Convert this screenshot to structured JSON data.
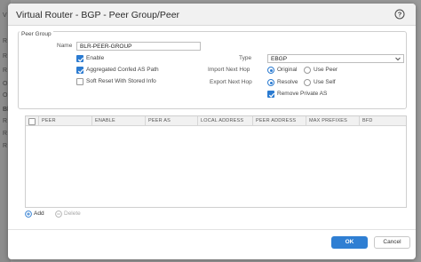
{
  "background": {
    "letters": [
      "V",
      "R",
      "R",
      "R",
      "O",
      "O",
      "Bl",
      "R",
      "R",
      "R"
    ]
  },
  "dialog": {
    "title": "Virtual Router - BGP - Peer Group/Peer",
    "help_icon": "question-circle-icon"
  },
  "peer_group": {
    "legend": "Peer Group",
    "name_label": "Name",
    "name_value": "BLR-PEER-GROUP",
    "enable": {
      "label": "Enable",
      "checked": true
    },
    "aggregated_confed": {
      "label": "Aggregated Confed AS Path",
      "checked": true
    },
    "soft_reset": {
      "label": "Soft Reset With Stored Info",
      "checked": false
    },
    "type_label": "Type",
    "type_value": "EBGP",
    "import_next_hop": {
      "label": "Import Next Hop",
      "options": [
        "Original",
        "Use Peer"
      ],
      "selected": "Original"
    },
    "export_next_hop": {
      "label": "Export Next Hop",
      "options": [
        "Resolve",
        "Use Self"
      ],
      "selected": "Resolve"
    },
    "remove_private_as": {
      "label": "Remove Private AS",
      "checked": true
    }
  },
  "peer_table": {
    "columns": [
      "PEER",
      "ENABLE",
      "PEER AS",
      "LOCAL ADDRESS",
      "PEER ADDRESS",
      "MAX PREFIXES",
      "BFD"
    ],
    "rows": []
  },
  "toolbar": {
    "add_label": "Add",
    "delete_label": "Delete"
  },
  "footer": {
    "ok_label": "OK",
    "cancel_label": "Cancel"
  },
  "colors": {
    "accent": "#2b7bd1",
    "ok_button": "#2f7fd3"
  }
}
